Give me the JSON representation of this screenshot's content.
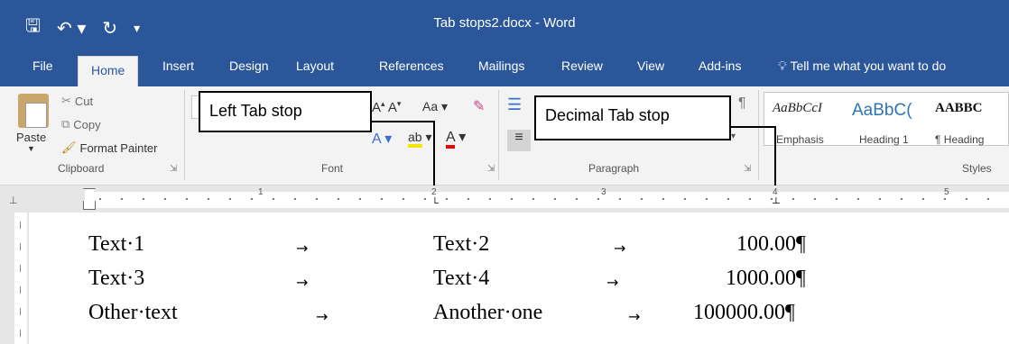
{
  "titlebar": {
    "doc_title": "Tab stops2.docx  -  Word",
    "qat": {
      "save_icon": "save-icon",
      "undo_icon": "undo-icon",
      "redo_icon": "redo-icon",
      "customize_icon": "customize-icon"
    }
  },
  "tabs": [
    "File",
    "Home",
    "Insert",
    "Design",
    "Layout",
    "References",
    "Mailings",
    "Review",
    "View",
    "Add-ins"
  ],
  "active_tab": "Home",
  "tell_me": "Tell me what you want to do",
  "clipboard": {
    "paste": "Paste",
    "cut": "Cut",
    "copy": "Copy",
    "format_painter": "Format Painter",
    "label": "Clipboard"
  },
  "font_group": {
    "label": "Font",
    "change_case": "Aa"
  },
  "paragraph_group": {
    "label": "Paragraph",
    "pilcrow": "¶"
  },
  "styles": {
    "label": "Styles",
    "items": [
      {
        "sample": "AaBbCcI",
        "name": "Emphasis"
      },
      {
        "sample": "AaBbC(",
        "name": "Heading 1"
      },
      {
        "sample": "AABBC",
        "name": "¶ Heading"
      }
    ]
  },
  "callouts": {
    "left_tab": "Left Tab stop",
    "decimal_tab": "Decimal Tab stop"
  },
  "ruler": {
    "numbers": [
      "1",
      "2",
      "3",
      "4",
      "5"
    ]
  },
  "document": {
    "rows": [
      {
        "col1": "Text·1",
        "col2": "Text·2",
        "col3": "100.00¶"
      },
      {
        "col1": "Text·3",
        "col2": "Text·4",
        "col3": "1000.00¶"
      },
      {
        "col1": "Other·text",
        "col2": "Another·one",
        "col3": "100000.00¶"
      }
    ],
    "tab_arrow": "→"
  },
  "colors": {
    "word_blue": "#2b579a",
    "ribbon_bg": "#f3f3f3"
  }
}
